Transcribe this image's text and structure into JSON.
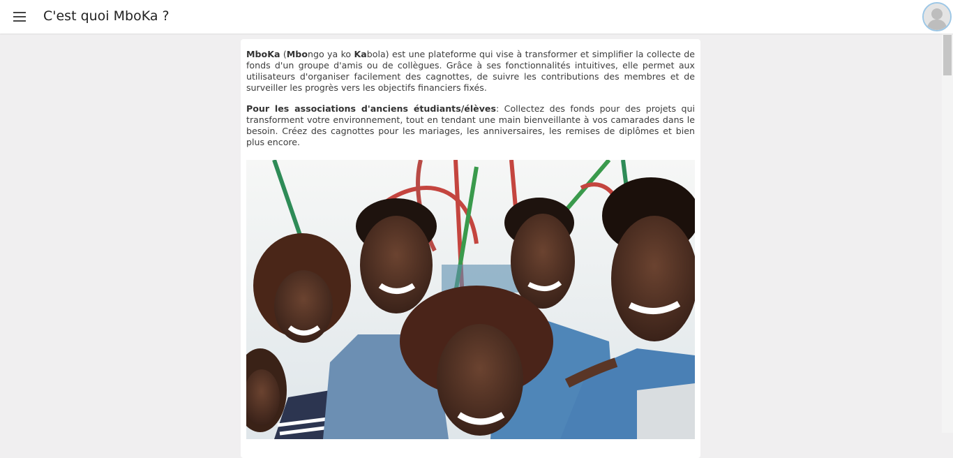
{
  "header": {
    "title": "C'est quoi MboKa ?",
    "menu_icon": "menu-icon",
    "avatar_icon": "user-avatar-icon"
  },
  "article": {
    "intro": {
      "brand": "MboKa",
      "paren_open": " (",
      "bold1": "Mbo",
      "mid1": "ngo ya ko ",
      "bold2": "Ka",
      "rest": "bola) est une plateforme qui vise à transformer et simplifier la collecte de fonds d'un groupe d'amis ou de collègues. Grâce à ses fonctionnalités intuitives, elle permet aux utilisateurs d'organiser facilement des cagnottes, de suivre les contributions des membres et de surveiller les progrès vers les objectifs financiers fixés."
    },
    "associations": {
      "heading": "Pour les associations d'anciens étudiants/élèves",
      "text": ": Collectez des fonds pour des projets qui transforment votre environnement, tout en tendant une main bienveillante à vos camarades dans le besoin. Créez des cagnottes pour les mariages, les anniversaires, les remises de diplômes et bien plus encore."
    },
    "photo_subject": "group-of-smiling-friends-photo"
  },
  "colors": {
    "background": "#f0eff0",
    "card": "#ffffff",
    "avatar_border": "#9cc7e6"
  }
}
